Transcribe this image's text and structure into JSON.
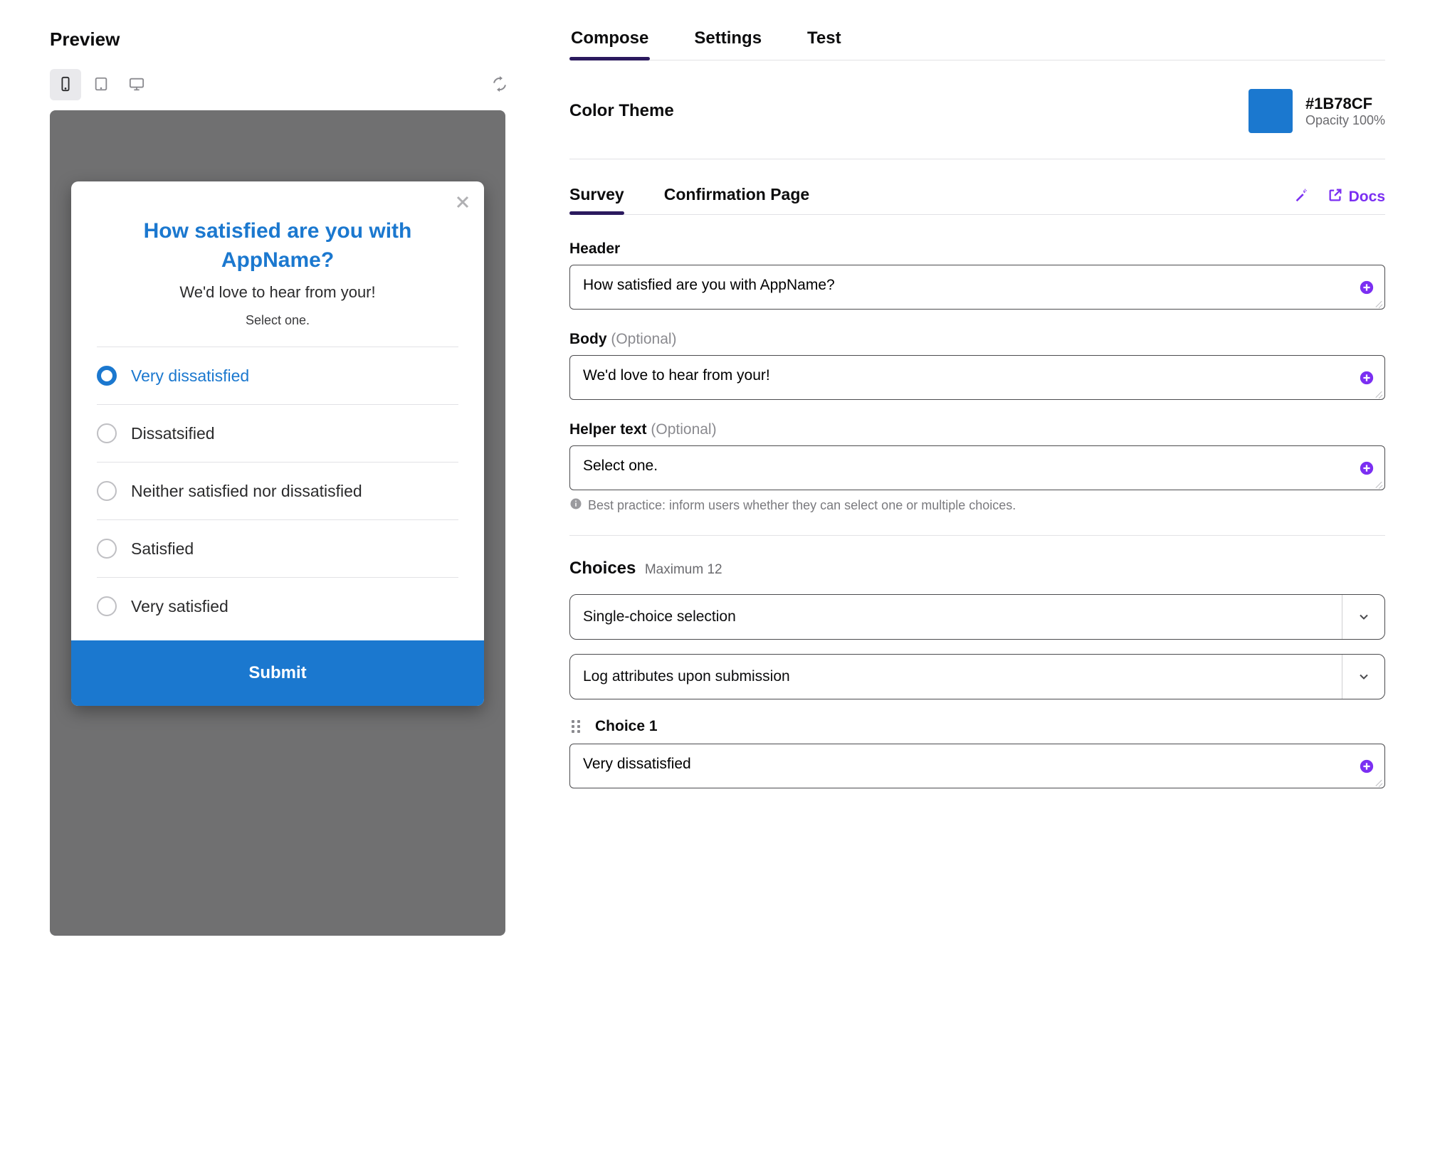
{
  "colors": {
    "accent": "#1B78CF",
    "purple": "#7b2ff2",
    "indicator": "#2b1a5e"
  },
  "left": {
    "title": "Preview",
    "devices": [
      "mobile",
      "tablet",
      "desktop"
    ],
    "active_device": "mobile"
  },
  "survey": {
    "header": "How satisfied are you with AppName?",
    "body": "We'd love to hear from your!",
    "helper": "Select one.",
    "options": [
      "Very dissatisfied",
      "Dissatsified",
      "Neither satisfied nor dissatisfied",
      "Satisfied",
      "Very satisfied"
    ],
    "selected_index": 0,
    "submit_label": "Submit"
  },
  "tabs_main": {
    "items": [
      "Compose",
      "Settings",
      "Test"
    ],
    "active": 0
  },
  "color_theme": {
    "label": "Color Theme",
    "hex": "#1B78CF",
    "opacity": "Opacity 100%"
  },
  "subtabs": {
    "items": [
      "Survey",
      "Confirmation Page"
    ],
    "active": 0,
    "docs_label": "Docs"
  },
  "fields": {
    "header": {
      "label": "Header",
      "value": "How satisfied are you with AppName?"
    },
    "body": {
      "label": "Body",
      "optional": "(Optional)",
      "value": "We'd love to hear from your!"
    },
    "helper": {
      "label": "Helper text",
      "optional": "(Optional)",
      "value": "Select one.",
      "hint": "Best practice: inform users whether they can select one or multiple choices."
    }
  },
  "choices": {
    "label": "Choices",
    "max_label": "Maximum 12",
    "select_type": "Single-choice selection",
    "log_attrs": "Log attributes upon submission",
    "items": [
      {
        "label": "Choice 1",
        "value": "Very dissatisfied"
      }
    ]
  }
}
